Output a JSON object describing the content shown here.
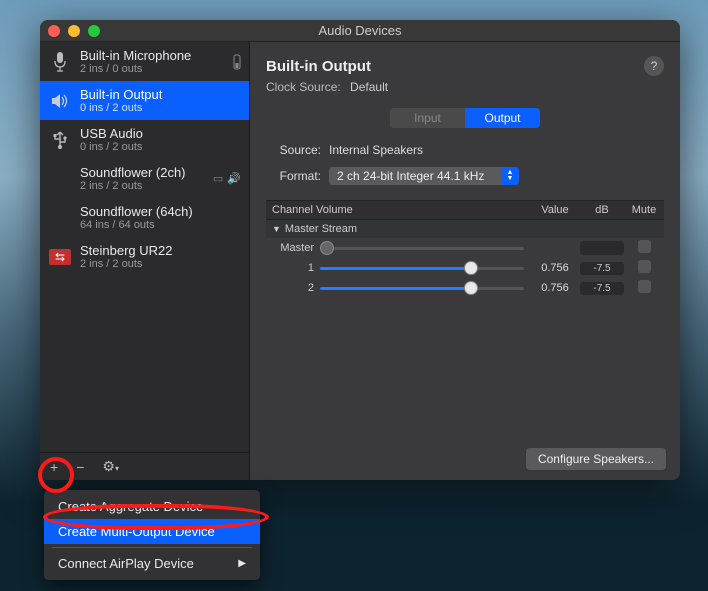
{
  "window": {
    "title": "Audio Devices"
  },
  "devices": [
    {
      "name": "Built-in Microphone",
      "io": "2 ins / 0 outs",
      "icon": "mic",
      "selected": false,
      "meter": true
    },
    {
      "name": "Built-in Output",
      "io": "0 ins / 2 outs",
      "icon": "speaker",
      "selected": true
    },
    {
      "name": "USB Audio",
      "io": "0 ins / 2 outs",
      "icon": "usb",
      "selected": false
    },
    {
      "name": "Soundflower (2ch)",
      "io": "2 ins / 2 outs",
      "icon": "flower",
      "selected": false,
      "badges": true
    },
    {
      "name": "Soundflower (64ch)",
      "io": "64 ins / 64 outs",
      "icon": "flower",
      "selected": false
    },
    {
      "name": "Steinberg UR22",
      "io": "2 ins / 2 outs",
      "icon": "steinberg",
      "selected": false
    }
  ],
  "footer_buttons": {
    "add": "+",
    "remove": "−",
    "gear": "⚙︎"
  },
  "detail": {
    "title": "Built-in Output",
    "clock_label": "Clock Source:",
    "clock_value": "Default",
    "tabs": {
      "input": "Input",
      "output": "Output"
    },
    "source_label": "Source:",
    "source_value": "Internal Speakers",
    "format_label": "Format:",
    "format_value": "2 ch 24-bit Integer 44.1 kHz",
    "volume_header": {
      "name": "Channel Volume",
      "value": "Value",
      "db": "dB",
      "mute": "Mute"
    },
    "stream_label": "Master Stream",
    "rows": [
      {
        "label": "Master",
        "value": "",
        "db": "",
        "slider": 0,
        "enabled": false
      },
      {
        "label": "1",
        "value": "0.756",
        "db": "-7.5",
        "slider": 0.756,
        "enabled": true
      },
      {
        "label": "2",
        "value": "0.756",
        "db": "-7.5",
        "slider": 0.756,
        "enabled": true
      }
    ],
    "configure_btn": "Configure Speakers..."
  },
  "popup": {
    "items": [
      {
        "label": "Create Aggregate Device",
        "highlight": false
      },
      {
        "label": "Create Multi-Output Device",
        "highlight": true
      }
    ],
    "airplay": "Connect AirPlay Device"
  }
}
